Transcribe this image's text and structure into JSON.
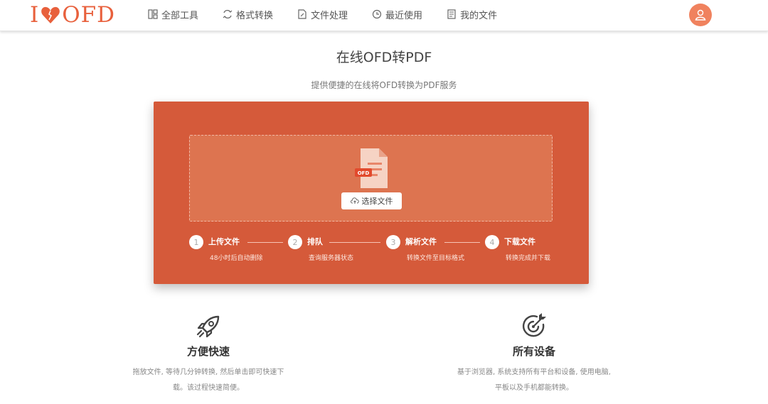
{
  "logo": {
    "prefix": "I",
    "suffix": "OFD"
  },
  "nav": [
    {
      "label": "全部工具",
      "icon": "grid-icon"
    },
    {
      "label": "格式转换",
      "icon": "convert-icon"
    },
    {
      "label": "文件处理",
      "icon": "file-edit-icon"
    },
    {
      "label": "最近使用",
      "icon": "recent-icon"
    },
    {
      "label": "我的文件",
      "icon": "document-icon"
    }
  ],
  "header": {
    "avatar_icon": "user-icon"
  },
  "page": {
    "title": "在线OFD转PDF",
    "subtitle": "提供便捷的在线将OFD转换为PDF服务"
  },
  "upload": {
    "file_badge": "OFD",
    "button_label": "选择文件"
  },
  "steps": [
    {
      "num": "1",
      "title": "上传文件",
      "desc": "48小时后自动删除"
    },
    {
      "num": "2",
      "title": "排队",
      "desc": "查询服务器状态"
    },
    {
      "num": "3",
      "title": "解析文件",
      "desc": "转换文件至目标格式"
    },
    {
      "num": "4",
      "title": "下载文件",
      "desc": "转换完成并下载"
    }
  ],
  "features": [
    {
      "icon": "rocket-icon",
      "title": "方便快速",
      "desc1": "拖放文件, 等待几分钟转换, 然后单击即可快速下",
      "desc2": "载。该过程快速简便。"
    },
    {
      "icon": "target-icon",
      "title": "所有设备",
      "desc1": "基于浏览器, 系统支持所有平台和设备, 使用电脑,",
      "desc2": "平板以及手机都能转换。"
    }
  ],
  "colors": {
    "brand": "#e8603c",
    "panel": "#d55a3a",
    "dropzone": "#dd7450"
  }
}
